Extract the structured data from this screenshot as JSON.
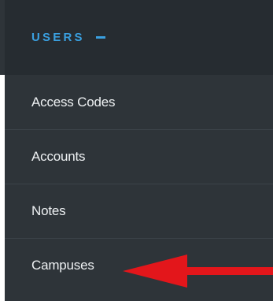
{
  "section": {
    "title": "USERS",
    "collapse_icon": "minus-icon",
    "accent_color": "#3aa0e0"
  },
  "menu": {
    "items": [
      {
        "label": "Access Codes"
      },
      {
        "label": "Accounts"
      },
      {
        "label": "Notes"
      },
      {
        "label": "Campuses"
      }
    ]
  },
  "annotation": {
    "icon": "red-arrow-icon",
    "color": "#e3161b"
  }
}
